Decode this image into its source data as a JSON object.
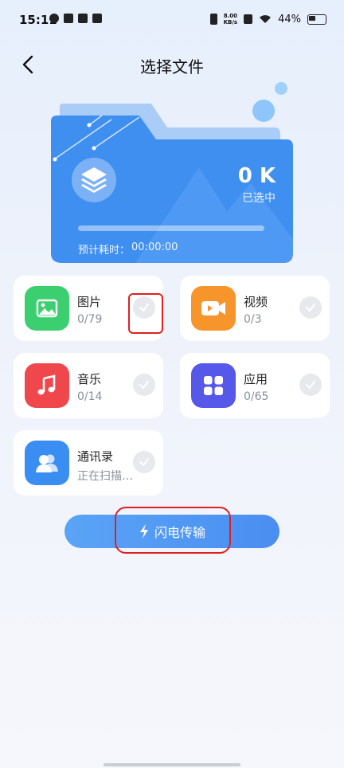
{
  "status_bar": {
    "time": "15:11",
    "net_speed_value": "8.00",
    "net_speed_unit": "KB/s",
    "battery_percent": "44%"
  },
  "header": {
    "title": "选择文件"
  },
  "summary": {
    "size_value": "0 K",
    "size_caption": "已选中",
    "eta_label": "预计耗时：",
    "eta_value": "00:00:00",
    "progress": 0
  },
  "categories": [
    {
      "title": "图片",
      "subtitle": "0/79",
      "icon": "image-icon",
      "color": "#3ccf6f"
    },
    {
      "title": "视频",
      "subtitle": "0/3",
      "icon": "video-icon",
      "color": "#f7952d"
    },
    {
      "title": "音乐",
      "subtitle": "0/14",
      "icon": "music-icon",
      "color": "#f0474c"
    },
    {
      "title": "应用",
      "subtitle": "0/65",
      "icon": "apps-icon",
      "color": "#5558e8"
    },
    {
      "title": "通讯录",
      "subtitle": "正在扫描…",
      "icon": "contacts-icon",
      "color": "#3a8ef2"
    }
  ],
  "actions": {
    "flash_transfer_label": "闪电传输"
  },
  "colors": {
    "primary": "#4a8ef0",
    "highlight": "#e02020"
  }
}
